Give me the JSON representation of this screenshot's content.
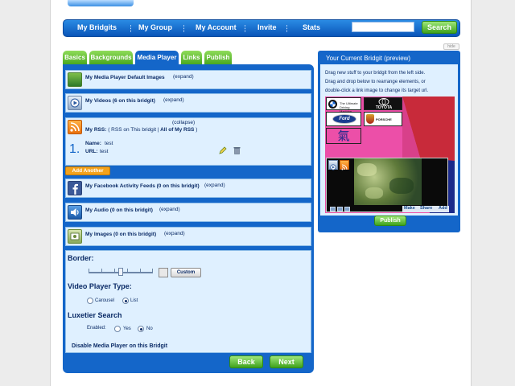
{
  "nav": {
    "items": [
      "My Bridgits",
      "My Group",
      "My Account",
      "Invite",
      "Stats"
    ],
    "search_value": "",
    "search_button": "Search"
  },
  "tabs": [
    "Basics",
    "Backgrounds",
    "Media Player",
    "Links",
    "Publish"
  ],
  "sections": {
    "default_images": {
      "title": "My Media Player Default Images",
      "action": "(expand)"
    },
    "videos": {
      "title": "My Videos (6 on this bridgit)",
      "action": "(expand)"
    },
    "rss": {
      "title_prefix": "My RSS:",
      "title_rest": "( RSS on This bridgit |",
      "title_all": "All of My RSS",
      "title_end": ")",
      "action": "(collapse)",
      "item": {
        "number": "1.",
        "name_label": "Name:",
        "name_value": "test",
        "url_label": "URL:",
        "url_value": "test"
      }
    },
    "add_another": "Add Another",
    "facebook": {
      "title": "My Facebook Activity Feeds (0 on this bridgit)",
      "action": "(expand)"
    },
    "audio": {
      "title": "My Audio (0 on this bridgit)",
      "action": "(expand)"
    },
    "images": {
      "title": "My Images (0 on this bridgit)",
      "action": "(expand)"
    }
  },
  "settings": {
    "border_label": "Border:",
    "border_level": 0.5,
    "custom_button": "Custom",
    "player_type_label": "Video Player Type:",
    "carousel": "Carousel",
    "list": "List",
    "luxetier_label": "Luxetier Search",
    "enabled_label": "Enabled:",
    "yes": "Yes",
    "no": "No",
    "disable_label": "Disable Media Player on this Bridgit"
  },
  "buttons": {
    "back": "Back",
    "next": "Next"
  },
  "preview": {
    "title": "Your Current Bridgit (preview)",
    "hide": "hide",
    "instructions": [
      "Drag new stuff to your bridgit from the left side.",
      "Drag and drop below to rearrange elements, or",
      "double-click a link image to change its target url."
    ],
    "logos": [
      "The Ultimate Driving Machine",
      "TOYOTA",
      "Ford",
      "PORSCHE",
      "氣"
    ],
    "player_buttons": [
      "Make",
      "Share",
      "Add"
    ],
    "publish": "Publish"
  },
  "colors": {
    "nav_blue": "#1466c9",
    "green": "#4aa81f",
    "orange": "#f3a21c",
    "pink": "#ec4fa8",
    "light_blue": "#dff0ff"
  }
}
